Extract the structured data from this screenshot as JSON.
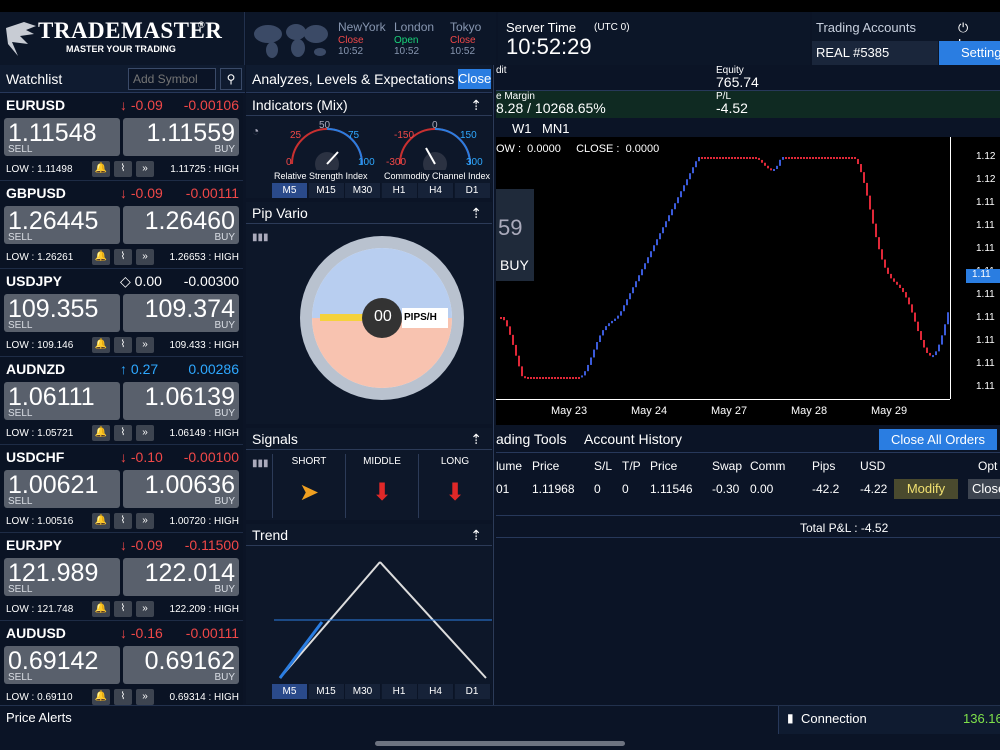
{
  "app": {
    "brand": "TRADEMASTER",
    "tagline": "MASTER YOUR TRADING"
  },
  "markets": [
    {
      "city": "NewYork",
      "status": "Close",
      "time": "10:52",
      "color": "#f04848"
    },
    {
      "city": "London",
      "status": "Open",
      "time": "10:52",
      "color": "#19d37a"
    },
    {
      "city": "Tokyo",
      "status": "Close",
      "time": "10:52",
      "color": "#f04848"
    }
  ],
  "server": {
    "label": "Server Time",
    "utc": "(UTC 0)",
    "time": "10:52:29"
  },
  "account": {
    "label": "Trading Accounts",
    "id": "REAL #5385",
    "logout": "Logo",
    "settings": "Setting"
  },
  "watchlist": {
    "title": "Watchlist",
    "add_placeholder": "Add Symbol",
    "symbols": [
      {
        "name": "EURUSD",
        "chg": "↓ -0.09",
        "chg2": "-0.00106",
        "chgColor": "red",
        "sell": "1.11548",
        "buy": "1.11559",
        "low": "LOW : 1.11498",
        "high": "1.11725 : HIGH"
      },
      {
        "name": "GBPUSD",
        "chg": "↓ -0.09",
        "chg2": "-0.00111",
        "chgColor": "red",
        "sell": "1.26445",
        "buy": "1.26460",
        "low": "LOW : 1.26261",
        "high": "1.26653 : HIGH"
      },
      {
        "name": "USDJPY",
        "chg": "◇ 0.00",
        "chg2": "-0.00300",
        "chgColor": "white",
        "sell": "109.355",
        "buy": "109.374",
        "low": "LOW : 109.146",
        "high": "109.433 : HIGH"
      },
      {
        "name": "AUDNZD",
        "chg": "↑ 0.27",
        "chg2": "0.00286",
        "chgColor": "blue",
        "sell": "1.06111",
        "buy": "1.06139",
        "low": "LOW : 1.05721",
        "high": "1.06149 : HIGH"
      },
      {
        "name": "USDCHF",
        "chg": "↓ -0.10",
        "chg2": "-0.00100",
        "chgColor": "red",
        "sell": "1.00621",
        "buy": "1.00636",
        "low": "LOW : 1.00516",
        "high": "1.00720 : HIGH"
      },
      {
        "name": "EURJPY",
        "chg": "↓ -0.09",
        "chg2": "-0.11500",
        "chgColor": "red",
        "sell": "121.989",
        "buy": "122.014",
        "low": "LOW : 121.748",
        "high": "122.209 : HIGH"
      },
      {
        "name": "AUDUSD",
        "chg": "↓ -0.16",
        "chg2": "-0.00111",
        "chgColor": "red",
        "sell": "0.69142",
        "buy": "0.69162",
        "low": "LOW : 0.69110",
        "high": "0.69314 : HIGH"
      }
    ],
    "sell_label": "SELL",
    "buy_label": "BUY"
  },
  "analyze": {
    "title": "Analyzes, Levels & Expectations",
    "close": "Close",
    "indicators_title": "Indicators (Mix)",
    "rsi": {
      "label": "Relative Strength Index",
      "ticks": [
        "25",
        "50",
        "75",
        "0",
        "100"
      ]
    },
    "cci": {
      "label": "Commodity Channel Index",
      "ticks": [
        "-150",
        "0",
        "150",
        "-300",
        "300"
      ]
    },
    "timeframes": [
      "M5",
      "M15",
      "M30",
      "H1",
      "H4",
      "D1"
    ],
    "pip_title": "Pip Vario",
    "pip_value": "00",
    "pip_unit": "PIPS/H",
    "signals_title": "Signals",
    "signal_cols": [
      "SHORT",
      "MIDDLE",
      "LONG"
    ],
    "trend_title": "Trend"
  },
  "chart": {
    "tf": [
      "W1",
      "MN1"
    ],
    "ohlc": "OW :  0.0000     CLOSE :  0.0000",
    "dates": [
      "May 23",
      "May 24",
      "May 27",
      "May 28",
      "May 29"
    ],
    "yticks": [
      "1.12",
      "1.12",
      "1.11",
      "1.11",
      "1.11",
      "1.11",
      "1.11",
      "1.11",
      "1.11",
      "1.11",
      "1.11"
    ],
    "buy_overlay": "BUY",
    "price_overlay": "59",
    "last_price": "1.11"
  },
  "summary": {
    "equity_label": "Equity",
    "equity": "765.74",
    "credit_label": "dit",
    "margin_label": "e Margin",
    "margin": "8.28 / 10268.65%",
    "pl_label": "P/L",
    "pl": "-4.52"
  },
  "orders": {
    "tabs": [
      "ading Tools",
      "Account History"
    ],
    "close_all": "Close All Orders",
    "headers": [
      "lume",
      "Price",
      "S/L",
      "T/P",
      "Price",
      "Swap",
      "Comm",
      "Pips",
      "USD",
      "Opt"
    ],
    "row": [
      "01",
      "1.11968",
      "0",
      "0",
      "1.11546",
      "-0.30",
      "0.00",
      "-42.2",
      "-4.22"
    ],
    "modify": "Modify",
    "close": "Close",
    "total": "Total P&L : -4.52"
  },
  "bottom": {
    "alerts": "Price Alerts",
    "connection": "Connection",
    "conn_value": "136.16"
  }
}
